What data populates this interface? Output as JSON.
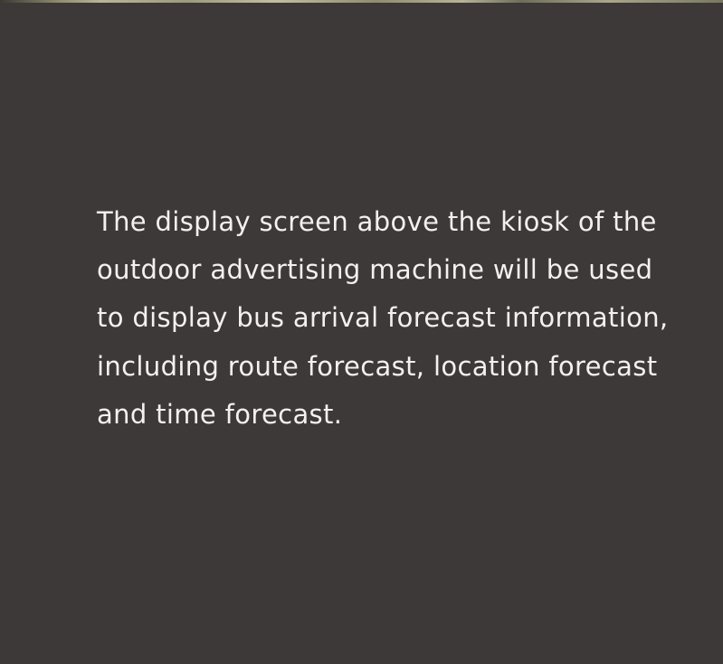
{
  "panel": {
    "description": "The display screen above the kiosk of the outdoor advertising machine will be used to display bus arrival forecast information, including route forecast, location forecast and time forecast."
  },
  "colors": {
    "background": "#3c3938",
    "text": "#f3f1ef"
  }
}
